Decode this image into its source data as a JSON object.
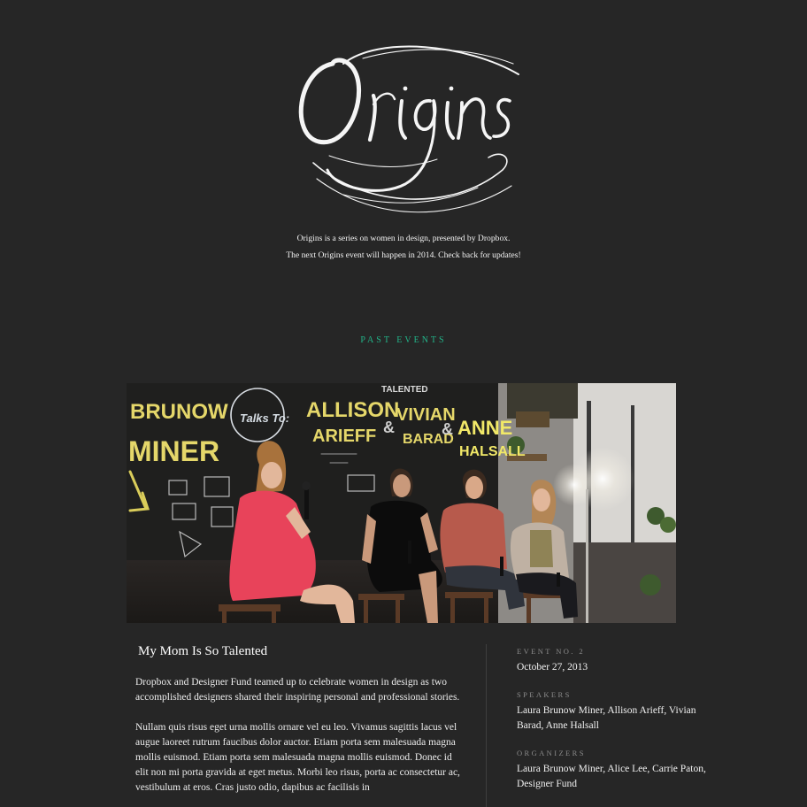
{
  "header": {
    "logo_text": "Origins",
    "intro_line_1": "Origins is a series on women in design, presented by Dropbox.",
    "intro_line_2": "The next Origins event will happen in 2014. Check back for updates!"
  },
  "past_events": {
    "section_title": "PAST EVENTS",
    "photo": {
      "chalk_names": [
        "BRUNOW",
        "MINER",
        "ALLISON",
        "ARIEFF",
        "VIVIAN",
        "BARAD",
        "ANNE",
        "HALSALL"
      ],
      "chalk_bubble": "Talks To:",
      "chalk_top": "TALENTED"
    },
    "event": {
      "title": "My Mom Is So Talented",
      "paragraph_1": "Dropbox and Designer Fund teamed up to celebrate women in design as two accomplished designers shared their inspiring personal and professional stories.",
      "paragraph_2": "Nullam quis risus eget urna mollis ornare vel eu leo. Vivamus sagittis lacus vel augue laoreet rutrum faucibus dolor auctor. Etiam porta sem malesuada magna mollis euismod. Etiam porta sem malesuada magna mollis euismod. Donec id elit non mi porta gravida at eget metus. Morbi leo risus, porta ac consectetur ac, vestibulum at eros. Cras justo odio, dapibus ac facilisis in",
      "event_label": "EVENT NO. 2",
      "date": "October 27, 2013",
      "speakers_label": "SPEAKERS",
      "speakers": "Laura Brunow Miner, Allison Arieff, Vivian Barad, Anne Halsall",
      "organizers_label": "ORGANIZERS",
      "organizers": "Laura Brunow Miner, Alice Lee, Carrie Paton, Designer Fund"
    }
  },
  "colors": {
    "background": "#262626",
    "accent": "#22b58a",
    "text": "#f2f2f2",
    "muted": "#8c8c8c"
  }
}
